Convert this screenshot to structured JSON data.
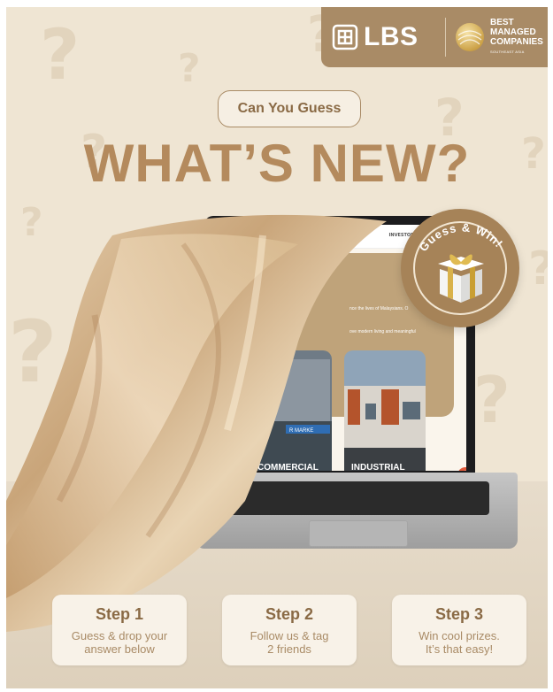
{
  "brand": {
    "logo_text": "LBS",
    "award_line1": "BEST",
    "award_line2": "MANAGED",
    "award_line3": "COMPANIES",
    "award_line4": "SOUTHEAST ASIA"
  },
  "hero": {
    "pill_label": "Can You Guess",
    "headline": "WHAT’S NEW?"
  },
  "badge": {
    "text": "Guess & Win!"
  },
  "laptop_screen": {
    "nav_item": "INVESTOR RE",
    "line1": "nce the lives of Malaysians. O",
    "line2": "ove modern living and meaningful",
    "card1_label": "COMMERCIAL",
    "card2_label": "INDUSTRIAL",
    "card1_sign": "R MARKE"
  },
  "steps": [
    {
      "title": "Step 1",
      "line1": "Guess & drop your",
      "line2": "answer below"
    },
    {
      "title": "Step 2",
      "line1": "Follow us & tag",
      "line2": "2 friends"
    },
    {
      "title": "Step 3",
      "line1": "Win cool prizes.",
      "line2": "It’s that easy!"
    }
  ],
  "colors": {
    "background": "#efe5d3",
    "accent": "#b48a5d",
    "brand_bar": "#a98b66"
  },
  "decorative_glyph": "?"
}
